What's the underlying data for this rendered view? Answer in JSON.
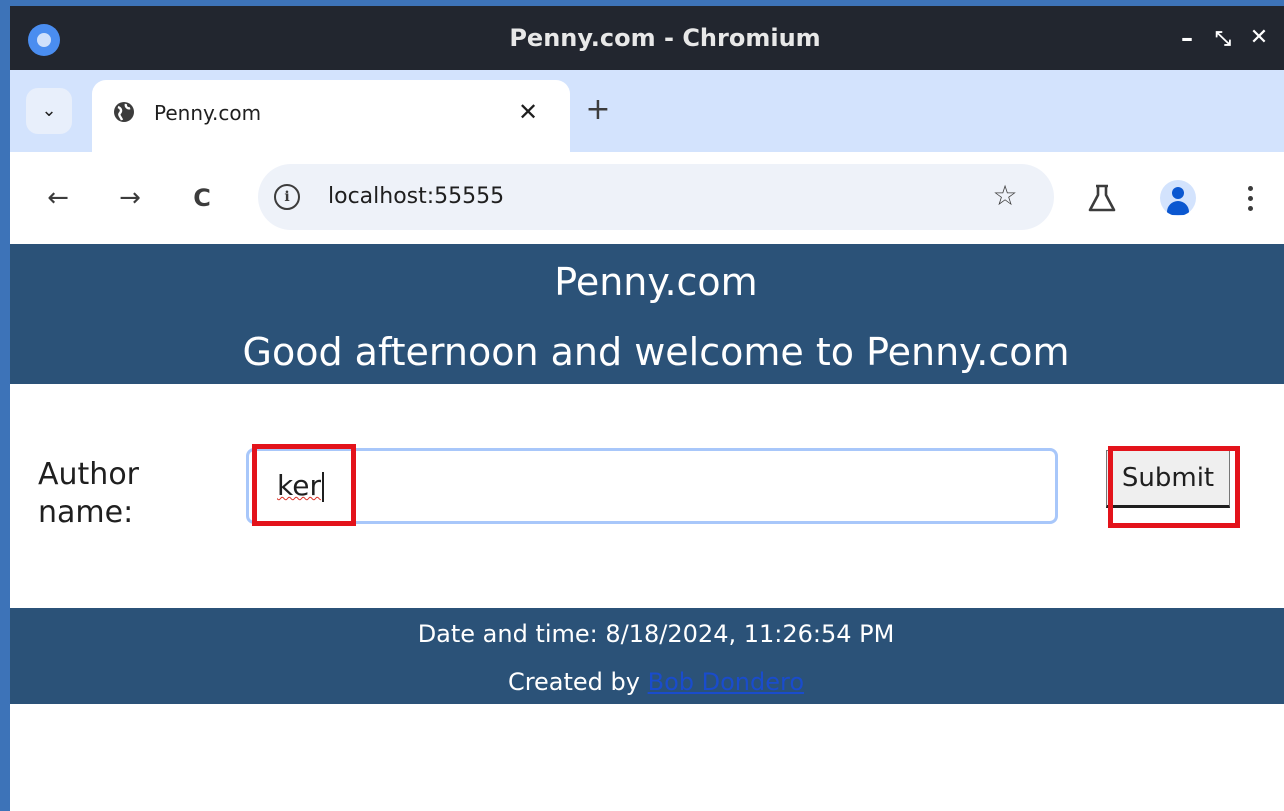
{
  "window": {
    "title": "Penny.com - Chromium",
    "minimize_glyph": "–",
    "restore_glyph": "⤡",
    "close_glyph": "✕"
  },
  "tabs": [
    {
      "title": "Penny.com",
      "icon": "globe-icon",
      "active": true
    }
  ],
  "tabstrip": {
    "close_glyph": "✕",
    "new_tab_glyph": "+",
    "list_glyph": "⌄"
  },
  "toolbar": {
    "back_glyph": "←",
    "forward_glyph": "→",
    "reload_glyph": "C",
    "info_glyph": "i",
    "url": "localhost:55555",
    "bookmark_glyph": "☆"
  },
  "page": {
    "site_title": "Penny.com",
    "welcome": "Good afternoon and welcome to Penny.com",
    "author_label": "Author name:",
    "author_value": "ker",
    "submit_label": "Submit",
    "footer_datetime": "Date and time: 8/18/2024, 11:26:54 PM",
    "footer_created_by": "Created by ",
    "footer_author_link": "Bob Dondero"
  },
  "colors": {
    "header_band": "#2b5278",
    "highlight": "#e3131b",
    "tabstrip": "#d3e3fd",
    "titlebar": "#22262f"
  }
}
